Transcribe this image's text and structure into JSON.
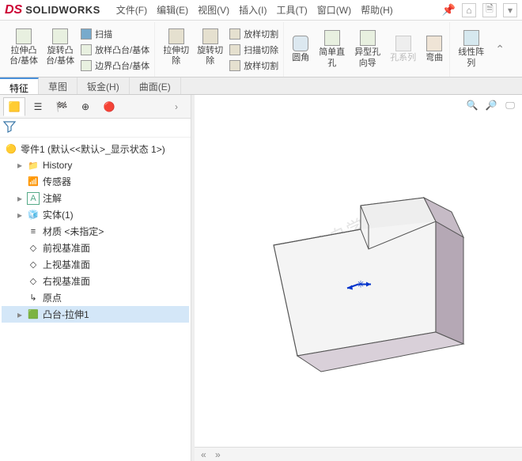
{
  "app": {
    "brand_ds": "DS",
    "brand_sw": "SOLIDWORKS"
  },
  "menus": [
    "文件(F)",
    "编辑(E)",
    "视图(V)",
    "插入(I)",
    "工具(T)",
    "窗口(W)",
    "帮助(H)"
  ],
  "ribbon": {
    "extrude_boss": "拉伸凸\n台/基体",
    "revolve_boss": "旋转凸\n台/基体",
    "sweep": "扫描",
    "loft": "放样凸台/基体",
    "boundary": "边界凸台/基体",
    "extrude_cut": "拉伸切\n除",
    "revolve_cut": "旋转切\n除",
    "loft_cut_t": "放样切割",
    "sweep_cut": "扫描切除",
    "loft_cut_b": "放样切割",
    "fillet": "圆角",
    "simple_hole": "简单直\n孔",
    "hole_wiz": "异型孔\n向导",
    "hole_series": "孔系列",
    "wrap": "弯曲",
    "linear_pattern": "线性阵\n列"
  },
  "tabs": [
    "特征",
    "草图",
    "钣金(H)",
    "曲面(E)"
  ],
  "tree": {
    "root": "零件1  (默认<<默认>_显示状态 1>)",
    "items": [
      {
        "label": "History",
        "icon": "📁",
        "arrow": "▸"
      },
      {
        "label": "传感器",
        "icon": "📶",
        "arrow": ""
      },
      {
        "label": "注解",
        "icon": "A",
        "arrow": "▸",
        "boxed": true
      },
      {
        "label": "实体(1)",
        "icon": "🧊",
        "arrow": "▸"
      },
      {
        "label": "材质 <未指定>",
        "icon": "≡",
        "arrow": ""
      },
      {
        "label": "前视基准面",
        "icon": "◇",
        "arrow": ""
      },
      {
        "label": "上视基准面",
        "icon": "◇",
        "arrow": ""
      },
      {
        "label": "右视基准面",
        "icon": "◇",
        "arrow": ""
      },
      {
        "label": "原点",
        "icon": "↳",
        "arrow": ""
      },
      {
        "label": "凸台-拉伸1",
        "icon": "🟩",
        "arrow": "▸",
        "selected": true
      }
    ]
  },
  "watermark": {
    "line1": "软件自学网",
    "line2": "WWW.RJZXW.COM"
  }
}
